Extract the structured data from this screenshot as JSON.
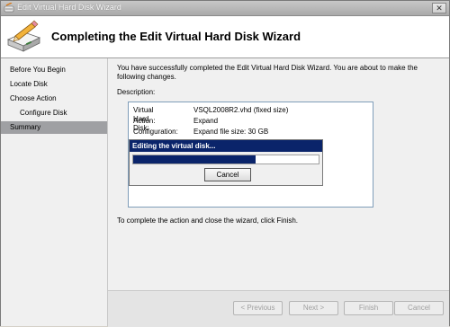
{
  "window": {
    "title": "Edit Virtual Hard Disk Wizard",
    "close_glyph": "✕"
  },
  "header": {
    "title": "Completing the Edit Virtual Hard Disk Wizard"
  },
  "nav": {
    "items": [
      {
        "label": "Before You Begin",
        "sub": false,
        "active": false
      },
      {
        "label": "Locate Disk",
        "sub": false,
        "active": false
      },
      {
        "label": "Choose Action",
        "sub": false,
        "active": false
      },
      {
        "label": "Configure Disk",
        "sub": true,
        "active": false
      },
      {
        "label": "Summary",
        "sub": false,
        "active": true
      }
    ]
  },
  "content": {
    "intro": "You have successfully completed the Edit Virtual Hard Disk Wizard. You are about to make the following changes.",
    "description_label": "Description:",
    "rows": [
      {
        "key": "Virtual Hard Disk:",
        "value": "VSQL2008R2.vhd (fixed size)"
      },
      {
        "key": "Action:",
        "value": "Expand"
      },
      {
        "key": "Configuration:",
        "value": "Expand file size: 30 GB"
      }
    ],
    "finish_note": "To complete the action and close the wizard, click Finish."
  },
  "progress_dialog": {
    "title": "Editing the virtual disk...",
    "progress_fraction": 0.66,
    "cancel_label": "Cancel"
  },
  "footer": {
    "previous_label": "< Previous",
    "next_label": "Next >",
    "finish_label": "Finish",
    "cancel_label": "Cancel"
  },
  "colors": {
    "progress_blue": "#0a246a",
    "nav_active": "#9fa0a3"
  },
  "icons": {
    "title": "wizard-disk-icon",
    "header": "disk-pencil-icon"
  }
}
